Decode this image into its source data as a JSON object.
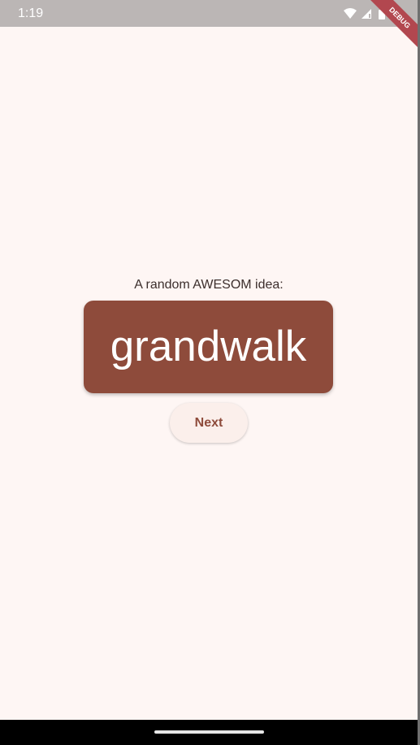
{
  "status_bar": {
    "time": "1:19",
    "icons": [
      "wifi-icon",
      "signal-icon",
      "battery-icon"
    ]
  },
  "debug_banner": {
    "label": "DEBUG",
    "color": "#b2474f"
  },
  "main": {
    "prompt": "A random AWESOM idea:",
    "idea": "grandwalk",
    "next_label": "Next"
  },
  "colors": {
    "background": "#fef6f4",
    "card": "#8e4b3b",
    "button_bg": "#fbefeb",
    "button_text": "#8e4b3b"
  }
}
